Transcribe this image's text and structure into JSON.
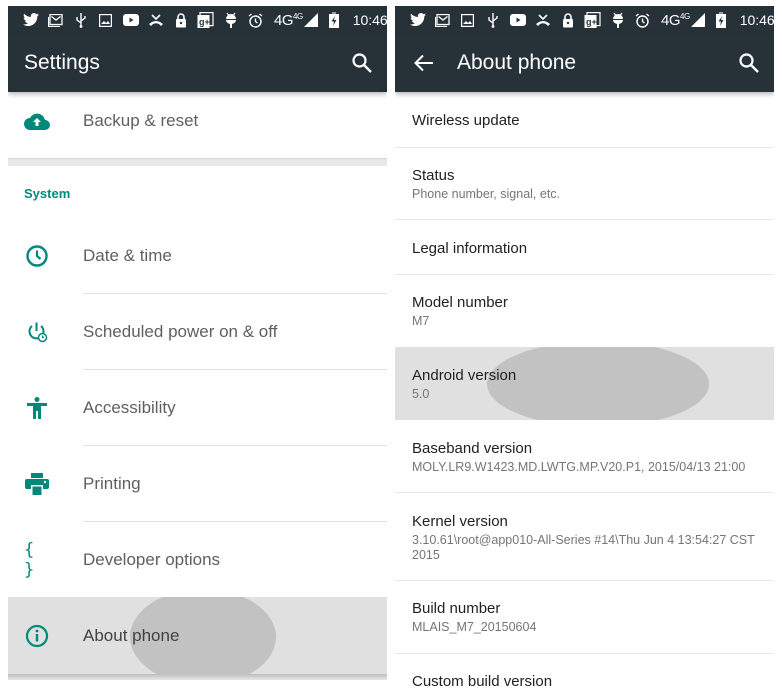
{
  "statusbar": {
    "left_icons": [
      "twitter-icon",
      "gmail-icon",
      "usb-icon",
      "image-icon",
      "youtube-icon",
      "missed-call-icon",
      "lock-icon",
      "google-plus-icon",
      "android-debug-icon"
    ],
    "right_icons": [
      "alarm-icon",
      "signal-icon",
      "battery-charging-icon"
    ],
    "network_label": "4G",
    "network_sup": "4G",
    "time": "10:46"
  },
  "left_screen": {
    "title": "Settings",
    "items_top": [
      {
        "label": "Backup & reset",
        "icon": "cloud-upload-icon"
      }
    ],
    "section_header": "System",
    "items": [
      {
        "label": "Date & time",
        "icon": "clock-icon"
      },
      {
        "label": "Scheduled power on & off",
        "icon": "scheduled-power-icon"
      },
      {
        "label": "Accessibility",
        "icon": "accessibility-icon"
      },
      {
        "label": "Printing",
        "icon": "printer-icon"
      },
      {
        "label": "Developer options",
        "icon": "braces-icon"
      },
      {
        "label": "About phone",
        "icon": "info-icon",
        "pressed": true
      }
    ],
    "accent_color": "#00897b"
  },
  "right_screen": {
    "title": "About phone",
    "items": [
      {
        "title": "Wireless update",
        "subtitle": ""
      },
      {
        "title": "Status",
        "subtitle": "Phone number, signal, etc."
      },
      {
        "title": "Legal information",
        "subtitle": ""
      },
      {
        "title": "Model number",
        "subtitle": "M7"
      },
      {
        "title": "Android version",
        "subtitle": "5.0",
        "pressed": true
      },
      {
        "title": "Baseband version",
        "subtitle": "MOLY.LR9.W1423.MD.LWTG.MP.V20.P1, 2015/04/13 21:00"
      },
      {
        "title": "Kernel version",
        "subtitle": "3.10.61\\root@app010-All-Series #14\\Thu Jun 4 13:54:27 CST 2015"
      },
      {
        "title": "Build number",
        "subtitle": "MLAIS_M7_20150604"
      },
      {
        "title": "Custom build version",
        "subtitle": ""
      }
    ]
  },
  "colors": {
    "appbar": "#263238",
    "accent": "#00897b",
    "pressed_bg": "#e0e0e0",
    "ripple": "#c2c2c2"
  }
}
